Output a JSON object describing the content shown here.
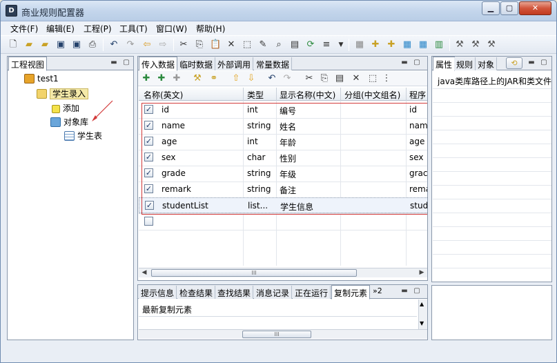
{
  "window": {
    "title": "商业规则配置器"
  },
  "menu": [
    {
      "label": "文件(F)"
    },
    {
      "label": "编辑(E)"
    },
    {
      "label": "工程(P)"
    },
    {
      "label": "工具(T)"
    },
    {
      "label": "窗口(W)"
    },
    {
      "label": "帮助(H)"
    }
  ],
  "project_view": {
    "tab": "工程视图",
    "tree": {
      "root": "test1",
      "folder": "学生录入",
      "children": [
        "添加",
        "对象库"
      ],
      "leaf": "学生表"
    }
  },
  "editor": {
    "tabs": [
      "传入数据",
      "临时数据",
      "外部调用",
      "常量数据"
    ],
    "columns": [
      "名称(英文)",
      "类型",
      "显示名称(中文)",
      "分组(中文组名)",
      "程序"
    ],
    "rows": [
      {
        "checked": true,
        "name": "id",
        "type": "int",
        "display": "编号",
        "group": "",
        "program": "id"
      },
      {
        "checked": true,
        "name": "name",
        "type": "string",
        "display": "姓名",
        "group": "",
        "program": "nam"
      },
      {
        "checked": true,
        "name": "age",
        "type": "int",
        "display": "年龄",
        "group": "",
        "program": "age"
      },
      {
        "checked": true,
        "name": "sex",
        "type": "char",
        "display": "性别",
        "group": "",
        "program": "sex"
      },
      {
        "checked": true,
        "name": "grade",
        "type": "string",
        "display": "年级",
        "group": "",
        "program": "grac"
      },
      {
        "checked": true,
        "name": "remark",
        "type": "string",
        "display": "备注",
        "group": "",
        "program": "rema"
      },
      {
        "checked": true,
        "name": "studentList",
        "type": "list...",
        "display": "学生信息",
        "group": "",
        "program": "stud"
      },
      {
        "checked": false,
        "name": "",
        "type": "",
        "display": "",
        "group": "",
        "program": ""
      }
    ],
    "check_mark": "✓"
  },
  "bottom_panel": {
    "tabs": [
      "提示信息",
      "检查结果",
      "查找结果",
      "消息记录",
      "正在运行",
      "复制元素"
    ],
    "overflow": "»2",
    "content": "最新复制元素"
  },
  "properties": {
    "tabs": [
      "属性",
      "规则",
      "对象"
    ],
    "text": "java类库路径上的JAR和类文件"
  },
  "colors": {
    "accent_red": "#d23a3a",
    "selection": "#f4e9a8"
  }
}
